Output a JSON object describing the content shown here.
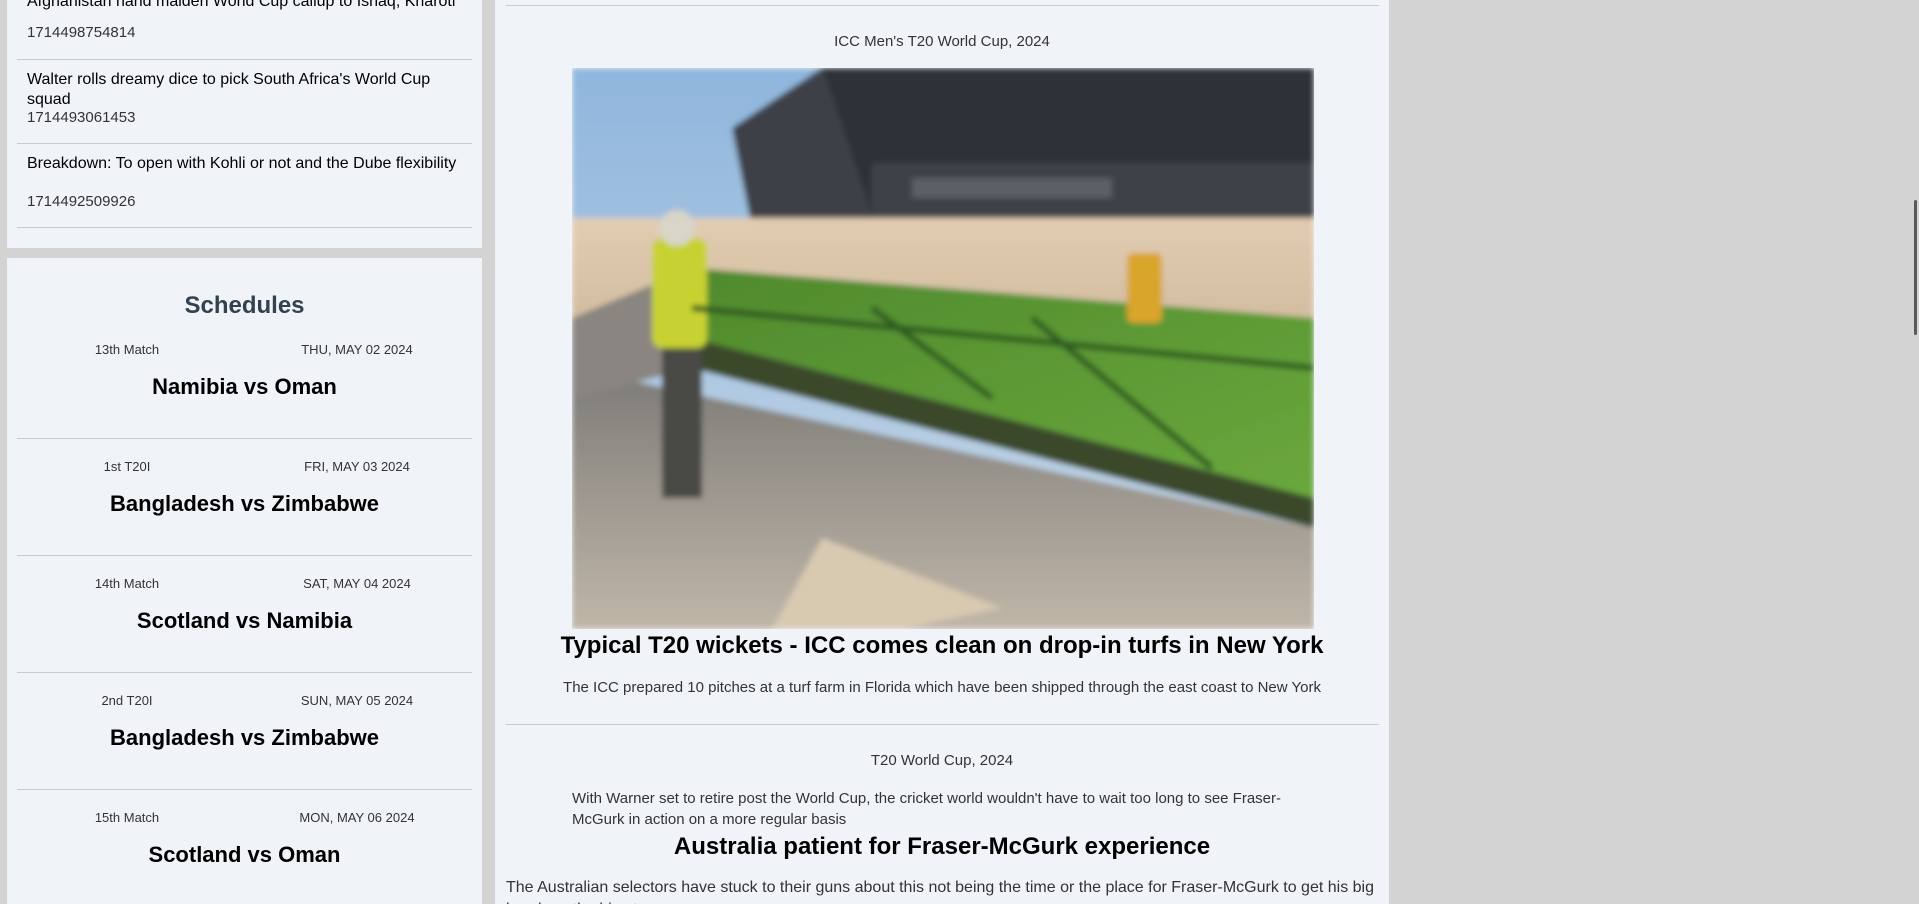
{
  "news": {
    "items": [
      {
        "title": "Afghanistan hand maiden World Cup callup to Ishaq, Kharoti",
        "timestamp": "1714498754814"
      },
      {
        "title": "Walter rolls dreamy dice to pick South Africa's World Cup squad",
        "timestamp": "1714493061453"
      },
      {
        "title": "Breakdown: To open with Kohli or not and the Dube flexibility",
        "timestamp": "1714492509926"
      }
    ]
  },
  "schedules": {
    "heading": "Schedules",
    "matches": [
      {
        "number": "13th Match",
        "date": "THU, MAY 02 2024",
        "title": "Namibia vs Oman"
      },
      {
        "number": "1st T20I",
        "date": "FRI, MAY 03 2024",
        "title": "Bangladesh vs Zimbabwe"
      },
      {
        "number": "14th Match",
        "date": "SAT, MAY 04 2024",
        "title": "Scotland vs Namibia"
      },
      {
        "number": "2nd T20I",
        "date": "SUN, MAY 05 2024",
        "title": "Bangladesh vs Zimbabwe"
      },
      {
        "number": "15th Match",
        "date": "MON, MAY 06 2024",
        "title": "Scotland vs Oman"
      }
    ]
  },
  "articles": [
    {
      "category": "ICC Men's T20 World Cup, 2024",
      "headline": "Typical T20 wickets - ICC comes clean on drop-in turfs in New York",
      "summary": "The ICC prepared 10 pitches at a turf farm in Florida which have been shipped through the east coast to New York"
    },
    {
      "category": "T20 World Cup, 2024",
      "intro": "With Warner set to retire post the World Cup, the cricket world wouldn't have to wait too long to see Fraser-McGurk in action on a more regular basis",
      "headline": "Australia patient for Fraser-McGurk experience",
      "body": "The Australian selectors have stuck to their guns about this not being the time or the place for Fraser-McGurk to get his big break on the big stage"
    }
  ]
}
